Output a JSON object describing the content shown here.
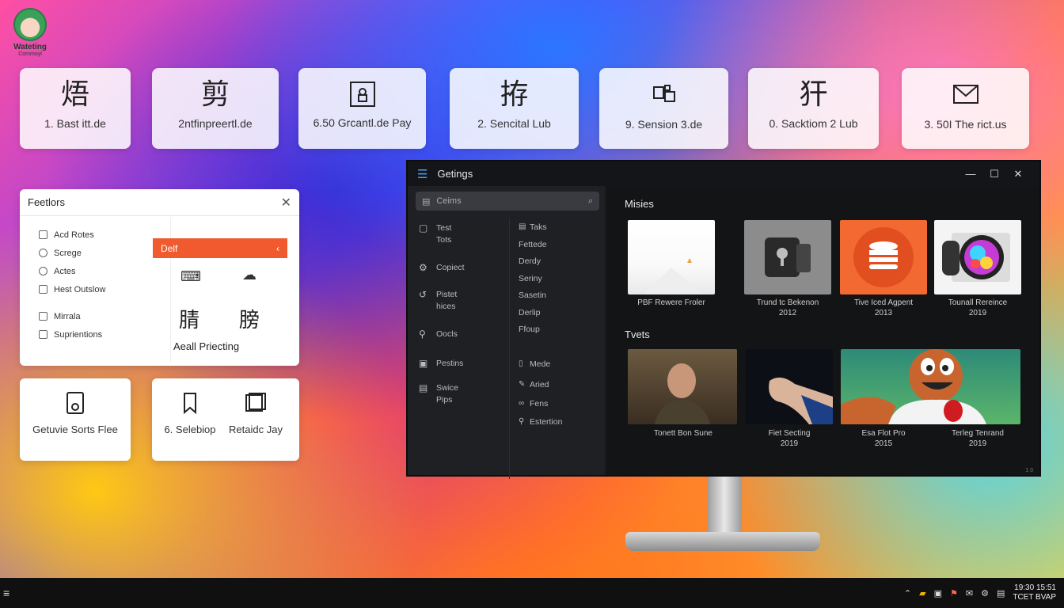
{
  "logo": {
    "text": "Wateting",
    "sub": "Commoyl"
  },
  "tiles": [
    {
      "glyph": "焐",
      "label": "1. Bast itt.de"
    },
    {
      "glyph": "剪",
      "label": "2ntfinpreertl.de"
    },
    {
      "label": "6.50 Grcantl.de Pay"
    },
    {
      "glyph": "拵",
      "label": "2. Sencital Lub"
    },
    {
      "label": "9. Sension 3.de"
    },
    {
      "glyph": "犴",
      "label": "0. Sacktiom 2 Lub"
    },
    {
      "label": "3. 50I The rict.us"
    }
  ],
  "features": {
    "title": "Feetlors",
    "items": [
      "Acd Rotes",
      "Screge",
      "Actes",
      "Hest Outslow",
      "Mirrala",
      "Suprientions"
    ],
    "selected": "Delf",
    "glyphs": [
      "腈",
      "膀"
    ],
    "footer": "Aeall Priecting"
  },
  "cards": {
    "card1": {
      "label": "Getuvie Sorts Flee"
    },
    "card2": {
      "left": "6. Selebiop",
      "right": "Retaidc Jay"
    }
  },
  "window": {
    "title": "Getings",
    "search_placeholder": "Ceims",
    "nav": [
      "Test Tots",
      "Copiect",
      "Pistet hices",
      "Oocls",
      "Pestins",
      "Swice Pips"
    ],
    "sub": [
      "Taks",
      "Fettede",
      "Derdy",
      "Seriny",
      "Sasetin",
      "Derlip",
      "Ffoup",
      "Mede",
      "Aried",
      "Fens",
      "Estertion"
    ],
    "section1": "Misies",
    "section2": "Tvets",
    "row1": [
      {
        "title": "PBF Rewere Froler",
        "year": ""
      },
      {
        "title": "Trund tc Bekenon",
        "year": "2012"
      },
      {
        "title": "Tive Iced Agpent",
        "year": "2013"
      },
      {
        "title": "Tounall Rereince",
        "year": "2019"
      }
    ],
    "row2": [
      {
        "title": "Tonett Bon Sune",
        "year": ""
      },
      {
        "title": "Fiet Secting",
        "year": "2019"
      },
      {
        "title": "Esa Flot Pro",
        "year": "2015"
      },
      {
        "title": "Terleg Tenrand",
        "year": "2019"
      }
    ],
    "corner": "1 0"
  },
  "taskbar": {
    "start": "≡",
    "clock_time": "19:30",
    "clock_date": "TCET BVAP",
    "clock_time2": "15:51"
  },
  "colors": {
    "accent_orange": "#f05a2e",
    "window_bg": "#1c1d20",
    "blue": "#4aa3ff"
  }
}
